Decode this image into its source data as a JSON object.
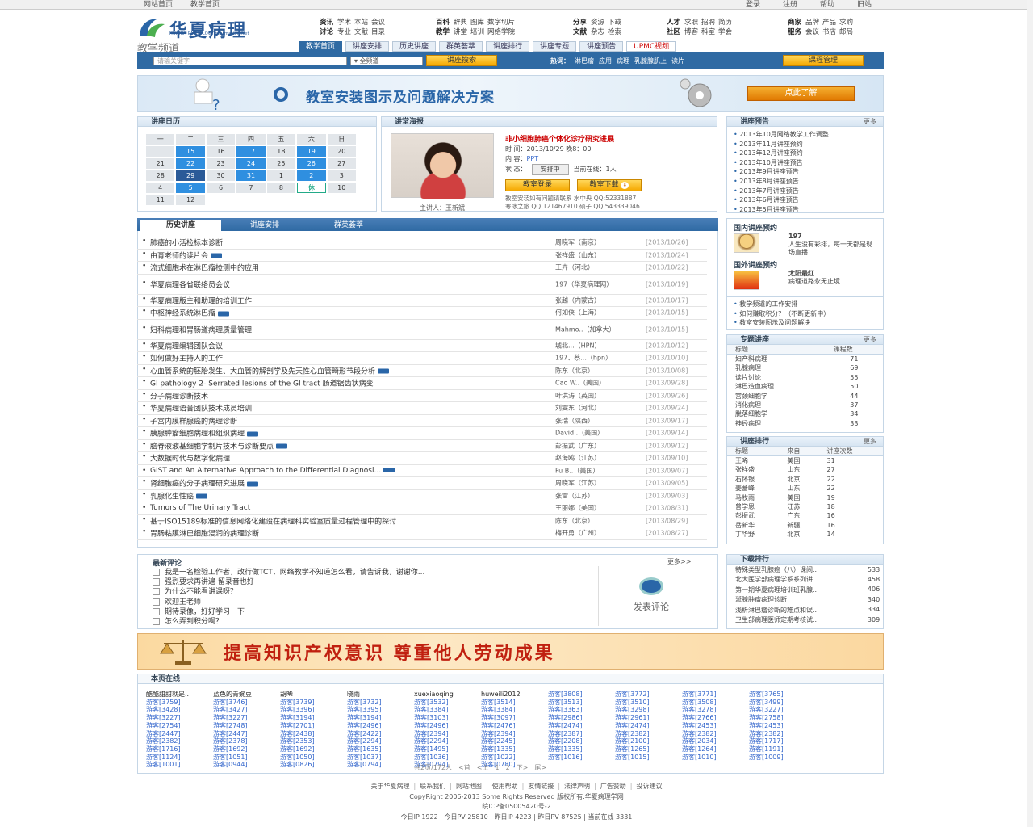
{
  "topbar": {
    "left": [
      "网站首页",
      "教学首页"
    ],
    "right": [
      "登录",
      "注册",
      "帮助",
      "旧站"
    ]
  },
  "logo": {
    "name": "华夏病理",
    "sub": "HUAXIA PATHOLOGYinformation.Net"
  },
  "nav": [
    {
      "rows": [
        [
          "资讯",
          "学术",
          "本站",
          "会议"
        ],
        [
          "讨论",
          "专业",
          "文献",
          "目录"
        ]
      ]
    },
    {
      "rows": [
        [
          "百科",
          "辞典",
          "图库",
          "数字切片"
        ],
        [
          "教学",
          "讲堂",
          "培训",
          "网络学院"
        ]
      ]
    },
    {
      "rows": [
        [
          "分享",
          "资源",
          "下载"
        ],
        [
          "文献",
          "杂志",
          "检索"
        ]
      ]
    },
    {
      "rows": [
        [
          "人才",
          "求职",
          "招聘",
          "简历"
        ],
        [
          "社区",
          "博客",
          "科室",
          "学会"
        ]
      ]
    },
    {
      "rows": [
        [
          "商家",
          "品牌",
          "产品",
          "求购"
        ],
        [
          "服务",
          "会议",
          "书店",
          "邮局"
        ]
      ]
    }
  ],
  "channel": "教学频道",
  "tabs": [
    "教学首页",
    "讲座安排",
    "历史讲座",
    "群英荟萃",
    "讲座排行",
    "讲座专题",
    "讲座预告",
    "UPMC视频"
  ],
  "search": {
    "placeholder": "请输关键字",
    "select": "全频道",
    "button": "讲座搜索",
    "hot_label": "热词：",
    "hot": [
      "淋巴瘤",
      "应用",
      "病理",
      "乳腺腺肌上",
      "读片"
    ],
    "course_btn": "课程管理"
  },
  "banner": {
    "text": "教室安装图示及问题解决方案",
    "button": "点此了解"
  },
  "calendar": {
    "title": "讲座日历",
    "weekdays": [
      "一",
      "二",
      "三",
      "四",
      "五",
      "六",
      "日"
    ],
    "rows": [
      [
        "",
        "15",
        "16",
        "17",
        "18",
        "19",
        "20"
      ],
      [
        "21",
        "22",
        "23",
        "24",
        "25",
        "26",
        "27"
      ],
      [
        "28",
        "29",
        "30",
        "31",
        "1",
        "2",
        "3"
      ],
      [
        "4",
        "5",
        "6",
        "7",
        "8",
        "休",
        "10"
      ],
      [
        "11",
        "12",
        "",
        "",
        "",
        "",
        ""
      ]
    ]
  },
  "poster": {
    "title": "讲堂海报",
    "lecture": "非小细胞肺癌个体化诊疗研究进展",
    "time_label": "时  间：",
    "time": "2013/10/29 晚8：00",
    "content_label": "内  容：",
    "content": "PPT",
    "status_label": "状  态：",
    "status": "安排中",
    "online_label": "当前在线：",
    "online": "1人",
    "btn_enter": "教室登录",
    "btn_download": "教室下载",
    "lecturer": "主讲人：王新斌",
    "contact1": "教室安装如有问题请联系 水中央 QQ:52331887",
    "contact2": "寒冰之旅 QQ:121467910 硕子 QQ:543339046"
  },
  "preview": {
    "title": "讲座预告",
    "more": "更多",
    "items": [
      "2013年10月网络教学工作调整...",
      "2013年11月讲座预约",
      "2013年12月讲座预约",
      "2013年10月讲座预告",
      "2013年9月讲座预告",
      "2013年8月讲座预告",
      "2013年7月讲座预告",
      "2013年6月讲座预告",
      "2013年5月讲座预告"
    ]
  },
  "hist_tabs": [
    "历史讲座",
    "讲座安排",
    "群英荟萃"
  ],
  "history": [
    {
      "t": "肺癌的小活检标本诊断",
      "v": false,
      "a": "周晓军（南京）",
      "d": "[2013/10/26]",
      "h": 15.5
    },
    {
      "t": "由育老师的读片会",
      "v": true,
      "a": "张祥盛（山东）",
      "d": "[2013/10/24]",
      "h": 15.5
    },
    {
      "t": "流式细胞术在淋巴瘤检测中的应用",
      "v": false,
      "a": "王卉（河北）",
      "d": "[2013/10/22]",
      "h": 15.5
    },
    {
      "t": "华夏病理各省联络员会议",
      "v": false,
      "a": "197（华夏病理网）",
      "d": "[2013/10/19]",
      "h": 25
    },
    {
      "t": "华夏病理版主和助理的培训工作",
      "v": false,
      "a": "张越（内蒙古）",
      "d": "[2013/10/17]",
      "h": 15.5
    },
    {
      "t": "中枢神经系统淋巴瘤",
      "v": true,
      "a": "何如侠（上海）",
      "d": "[2013/10/15]",
      "h": 15.5
    },
    {
      "t": "妇科病理和胃肠道病理质量管理",
      "v": false,
      "a": "Mahmo..（加拿大）",
      "d": "[2013/10/15]",
      "h": 25
    },
    {
      "t": "华夏病理编辑团队会议",
      "v": false,
      "a": "城北...（HPN）",
      "d": "[2013/10/12]",
      "h": 15.5
    },
    {
      "t": "如何做好主持人的工作",
      "v": false,
      "a": "197、蔡...（hpn）",
      "d": "[2013/10/10]",
      "h": 15.5
    },
    {
      "t": "心血管系统的胚胎发生、大血管的解剖学及先天性心血管畸形节段分析",
      "v": true,
      "a": "陈东（北京）",
      "d": "[2013/10/08]",
      "h": 15.5
    },
    {
      "t": "GI pathology 2- Serrated lesions of the GI tract 肠道锯齿状病变",
      "v": false,
      "a": "Cao W..（美国）",
      "d": "[2013/09/28]",
      "h": 15.5
    },
    {
      "t": "分子病理诊断技术",
      "v": false,
      "a": "叶洪涛（英国）",
      "d": "[2013/09/26]",
      "h": 15.5
    },
    {
      "t": "华夏病理语音团队技术成员培训",
      "v": false,
      "a": "刘雯东（河北）",
      "d": "[2013/09/24]",
      "h": 15.5
    },
    {
      "t": "子宫内膜样腺癌的病理诊断",
      "v": false,
      "a": "张瑞（陕西）",
      "d": "[2013/09/17]",
      "h": 15.5
    },
    {
      "t": "胰腺肿瘤细胞病理和组织病理",
      "v": true,
      "a": "David..（美国）",
      "d": "[2013/09/14]",
      "h": 15.5
    },
    {
      "t": "脑脊液液基细胞学制片技术与诊断要点",
      "v": true,
      "a": "彭振武（广东）",
      "d": "[2013/09/12]",
      "h": 15.5
    },
    {
      "t": "大数据时代与数字化病理",
      "v": false,
      "a": "赵海鸥（江苏）",
      "d": "[2013/09/10]",
      "h": 15.5
    },
    {
      "t": "GIST and An Alternative Approach to the Differential Diagnosi...",
      "v": true,
      "a": "Fu B..（美国）",
      "d": "[2013/09/07]",
      "h": 15.5
    },
    {
      "t": "肾细胞癌的分子病理研究进展",
      "v": true,
      "a": "周晓军（江苏）",
      "d": "[2013/09/05]",
      "h": 15.5
    },
    {
      "t": "乳腺化生性癌",
      "v": true,
      "a": "张雷（江苏）",
      "d": "[2013/09/03]",
      "h": 15.5
    },
    {
      "t": "Tumors of The Urinary Tract",
      "v": false,
      "a": "王丽娜（美国）",
      "d": "[2013/08/31]",
      "h": 15.5
    },
    {
      "t": "基于ISO15189标准的信息网络化建设在病理科实验室质量过程管理中的探讨",
      "v": false,
      "a": "陈东（北京）",
      "d": "[2013/08/29]",
      "h": 15.5
    },
    {
      "t": "胃肠粘膜淋巴细胞浸润的病理诊断",
      "v": false,
      "a": "梅开勇（广州）",
      "d": "[2013/08/27]",
      "h": 15.5
    }
  ],
  "intl": {
    "dom_title": "国内讲座预约",
    "dom_user": "197",
    "dom_text": "人生没有彩排，每一天都是现场直播",
    "for_title": "国外讲座预约",
    "for_user": "太阳最红",
    "for_text": "病理道路永无止境"
  },
  "links": [
    "教学频道的工作安排",
    "如何赚取积分？（不断更新中）",
    "教室安装图示及问题解决"
  ],
  "topics": {
    "title": "专题讲座",
    "more": "更多",
    "h1": "标题",
    "h2": "课程数",
    "rows": [
      [
        "妇产科病理",
        "71"
      ],
      [
        "乳腺病理",
        "69"
      ],
      [
        "读片讨论",
        "55"
      ],
      [
        "淋巴造血病理",
        "50"
      ],
      [
        "宫颈细胞学",
        "44"
      ],
      [
        "消化病理",
        "37"
      ],
      [
        "脱落细胞学",
        "34"
      ],
      [
        "神经病理",
        "33"
      ]
    ]
  },
  "rank": {
    "title": "讲座排行",
    "more": "更多",
    "h1": "标题",
    "h2": "来自",
    "h3": "讲座次数",
    "rows": [
      [
        "王晞",
        "美国",
        "31"
      ],
      [
        "张祥盛",
        "山东",
        "27"
      ],
      [
        "石怀银",
        "北京",
        "22"
      ],
      [
        "姜蕃峰",
        "山东",
        "22"
      ],
      [
        "马牧雨",
        "美国",
        "19"
      ],
      [
        "曾学思",
        "江苏",
        "18"
      ],
      [
        "彭振武",
        "广东",
        "16"
      ],
      [
        "岳新华",
        "新疆",
        "16"
      ],
      [
        "丁华野",
        "北京",
        "14"
      ]
    ]
  },
  "comments": {
    "title": "最新评论",
    "more": "更多>>",
    "items": [
      "我是一名检验工作者，改行做TCT，网络教学不知道怎么看，请告诉我，谢谢你...",
      "强烈要求再讲遍 留录音也好",
      "为什么不能看讲课呀？",
      "欢迎王老师",
      "期待录像，好好学习一下",
      "怎么弄到积分啊？"
    ],
    "post": "发表评论"
  },
  "downloads": {
    "title": "下载排行",
    "rows": [
      [
        "特殊类型乳腺癌（八）课间...",
        "533"
      ],
      [
        "北大医学部病理学系系列讲...",
        "458"
      ],
      [
        "第一期华夏病理培训班乳腺...",
        "406"
      ],
      [
        "涎腺肿瘤病理诊断",
        "340"
      ],
      [
        "浅析淋巴瘤诊断的难点和误...",
        "334"
      ],
      [
        "卫生部病理医师定期考核试...",
        "309"
      ]
    ]
  },
  "warn": "提高知识产权意识  尊重他人劳动成果",
  "online": {
    "title": "本页在线",
    "names": [
      "酷酷甜甜就是...",
      "蓝色的青豌豆",
      "胡晞",
      "晓雨",
      "xuexiaoqing",
      "huweili2012",
      "游客[3808]",
      "游客[3772]",
      "游客[3771]",
      "游客[3765]",
      "游客[3759]",
      "游客[3746]",
      "游客[3739]",
      "游客[3732]",
      "游客[3532]",
      "游客[3514]",
      "游客[3513]",
      "游客[3510]",
      "游客[3508]",
      "游客[3499]",
      "游客[3428]",
      "游客[3427]",
      "游客[3396]",
      "游客[3395]",
      "游客[3384]",
      "游客[3384]",
      "游客[3363]",
      "游客[3298]",
      "游客[3278]",
      "游客[3227]",
      "游客[3227]",
      "游客[3227]",
      "游客[3194]",
      "游客[3194]",
      "游客[3103]",
      "游客[3097]",
      "游客[2986]",
      "游客[2961]",
      "游客[2766]",
      "游客[2758]",
      "游客[2754]",
      "游客[2748]",
      "游客[2701]",
      "游客[2496]",
      "游客[2496]",
      "游客[2476]",
      "游客[2474]",
      "游客[2474]",
      "游客[2453]",
      "游客[2453]",
      "游客[2447]",
      "游客[2447]",
      "游客[2438]",
      "游客[2422]",
      "游客[2394]",
      "游客[2394]",
      "游客[2387]",
      "游客[2382]",
      "游客[2382]",
      "游客[2382]",
      "游客[2382]",
      "游客[2378]",
      "游客[2353]",
      "游客[2294]",
      "游客[2294]",
      "游客[2245]",
      "游客[2208]",
      "游客[2100]",
      "游客[2034]",
      "游客[1717]",
      "游客[1716]",
      "游客[1692]",
      "游客[1692]",
      "游客[1635]",
      "游客[1495]",
      "游客[1335]",
      "游客[1335]",
      "游客[1265]",
      "游客[1264]",
      "游客[1191]",
      "游客[1124]",
      "游客[1051]",
      "游客[1050]",
      "游客[1037]",
      "游客[1036]",
      "游客[1022]",
      "游客[1016]",
      "游客[1015]",
      "游客[1010]",
      "游客[1009]",
      "游客[1001]",
      "游客[0944]",
      "游客[0826]",
      "游客[0794]",
      "游客[0794]",
      "游客[0780]"
    ],
    "pager": [
      "共2页/172人",
      "<首",
      "<上",
      "1",
      "2",
      "下>",
      "尾>"
    ]
  },
  "footer": {
    "links": [
      "关于华夏病理",
      "联系我们",
      "网站地图",
      "使用帮助",
      "友情链接",
      "法律声明",
      "广告赞助",
      "投诉建议"
    ],
    "copy": "CopyRight 2006-2013 Some Rights Reserved 版权所有:华夏病理学网",
    "icp": "皖ICP备05005420号-2",
    "stats": "今日IP 1922 | 今日PV 25810 | 昨日IP 4223 | 昨日PV 87525 | 当前在线 3331"
  },
  "colors": {
    "brand": "#2f6aa3",
    "accent": "#f5a800",
    "alert": "#c00000"
  }
}
